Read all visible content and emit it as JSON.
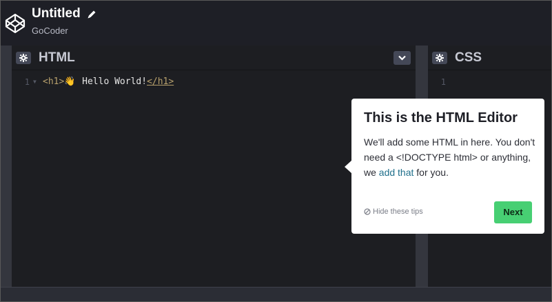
{
  "header": {
    "title": "Untitled",
    "subtitle": "GoCoder",
    "logo_icon": "codepen-logo-icon",
    "edit_icon": "pencil-icon"
  },
  "html_pane": {
    "title": "HTML",
    "settings_icon": "gear-icon",
    "collapse_icon": "chevron-down-icon",
    "lines": [
      {
        "number": "1",
        "open_tag": "<h1>",
        "emoji": "👋",
        "text": " Hello World!",
        "close_tag": "</h1>"
      }
    ]
  },
  "css_pane": {
    "title": "CSS",
    "settings_icon": "gear-icon",
    "lines": [
      {
        "number": "1"
      }
    ]
  },
  "tooltip": {
    "title": "This is the HTML Editor",
    "body_before": "We'll add some HTML in here. You don't need a <!DOCTYPE html> or anything, we ",
    "body_link": "add that",
    "body_after": " for you.",
    "hide_label": "Hide these tips",
    "hide_icon": "cancel-circle-icon",
    "next_label": "Next"
  },
  "colors": {
    "header_bg": "#1e1f26",
    "pane_bg": "#1d1e22",
    "divider": "#34363e",
    "accent_green": "#47cf73",
    "tag_color": "#b7a06c",
    "link_color": "#1f6f8b"
  }
}
